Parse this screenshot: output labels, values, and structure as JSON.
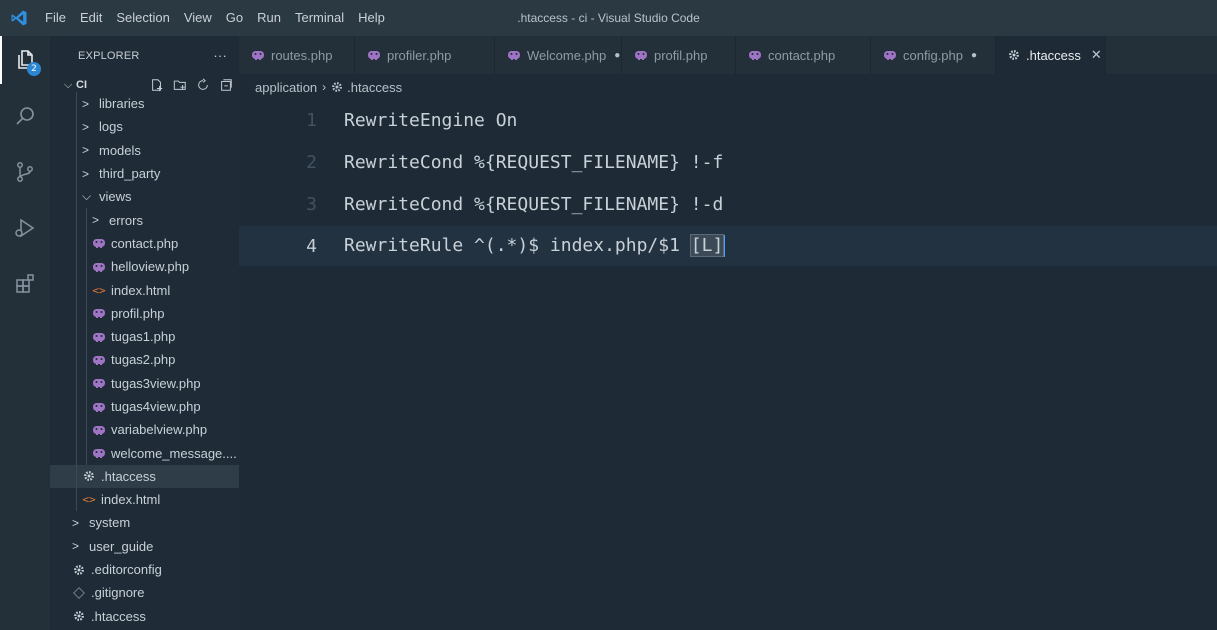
{
  "window": {
    "title": ".htaccess - ci - Visual Studio Code"
  },
  "menu": [
    "File",
    "Edit",
    "Selection",
    "View",
    "Go",
    "Run",
    "Terminal",
    "Help"
  ],
  "activitybar": {
    "badge": "2"
  },
  "sidebar": {
    "title": "EXPLORER",
    "more": "···",
    "section": "CI"
  },
  "tree": [
    {
      "label": "libraries",
      "kind": "folder-closed",
      "depth": 1
    },
    {
      "label": "logs",
      "kind": "folder-closed",
      "depth": 1
    },
    {
      "label": "models",
      "kind": "folder-closed",
      "depth": 1
    },
    {
      "label": "third_party",
      "kind": "folder-closed",
      "depth": 1
    },
    {
      "label": "views",
      "kind": "folder-open",
      "depth": 1
    },
    {
      "label": "errors",
      "kind": "folder-closed",
      "depth": 2
    },
    {
      "label": "contact.php",
      "kind": "php",
      "depth": 2
    },
    {
      "label": "helloview.php",
      "kind": "php",
      "depth": 2
    },
    {
      "label": "index.html",
      "kind": "html",
      "depth": 2
    },
    {
      "label": "profil.php",
      "kind": "php",
      "depth": 2
    },
    {
      "label": "tugas1.php",
      "kind": "php",
      "depth": 2
    },
    {
      "label": "tugas2.php",
      "kind": "php",
      "depth": 2
    },
    {
      "label": "tugas3view.php",
      "kind": "php",
      "depth": 2
    },
    {
      "label": "tugas4view.php",
      "kind": "php",
      "depth": 2
    },
    {
      "label": "variabelview.php",
      "kind": "php",
      "depth": 2
    },
    {
      "label": "welcome_message....",
      "kind": "php",
      "depth": 2
    },
    {
      "label": ".htaccess",
      "kind": "gear",
      "depth": 1,
      "selected": true
    },
    {
      "label": "index.html",
      "kind": "html",
      "depth": 1
    },
    {
      "label": "system",
      "kind": "folder-closed",
      "depth": 0
    },
    {
      "label": "user_guide",
      "kind": "folder-closed",
      "depth": 0
    },
    {
      "label": ".editorconfig",
      "kind": "gear",
      "depth": 0
    },
    {
      "label": ".gitignore",
      "kind": "git",
      "depth": 0
    },
    {
      "label": ".htaccess",
      "kind": "gear",
      "depth": 0
    }
  ],
  "tabs": [
    {
      "label": "routes.php",
      "kind": "php",
      "modified": false,
      "active": false
    },
    {
      "label": "profiler.php",
      "kind": "php",
      "modified": false,
      "active": false
    },
    {
      "label": "Welcome.php",
      "kind": "php",
      "modified": true,
      "active": false
    },
    {
      "label": "profil.php",
      "kind": "php",
      "modified": false,
      "active": false
    },
    {
      "label": "contact.php",
      "kind": "php",
      "modified": false,
      "active": false
    },
    {
      "label": "config.php",
      "kind": "php",
      "modified": true,
      "active": false
    },
    {
      "label": ".htaccess",
      "kind": "gear",
      "modified": false,
      "active": true
    }
  ],
  "breadcrumb": {
    "folder": "application",
    "file": ".htaccess"
  },
  "editor": {
    "lines": [
      {
        "num": "1",
        "text": "RewriteEngine On"
      },
      {
        "num": "2",
        "text": "RewriteCond %{REQUEST_FILENAME} !-f"
      },
      {
        "num": "3",
        "text": "RewriteCond %{REQUEST_FILENAME} !-d"
      },
      {
        "num": "4",
        "text": "RewriteRule ^(.*)$ index.php/$1 ",
        "bracket": "[L]",
        "current": true
      }
    ]
  },
  "colors": {
    "php_icon": "#a074c4",
    "html_icon": "#e37933",
    "accent": "#2b87d3"
  }
}
